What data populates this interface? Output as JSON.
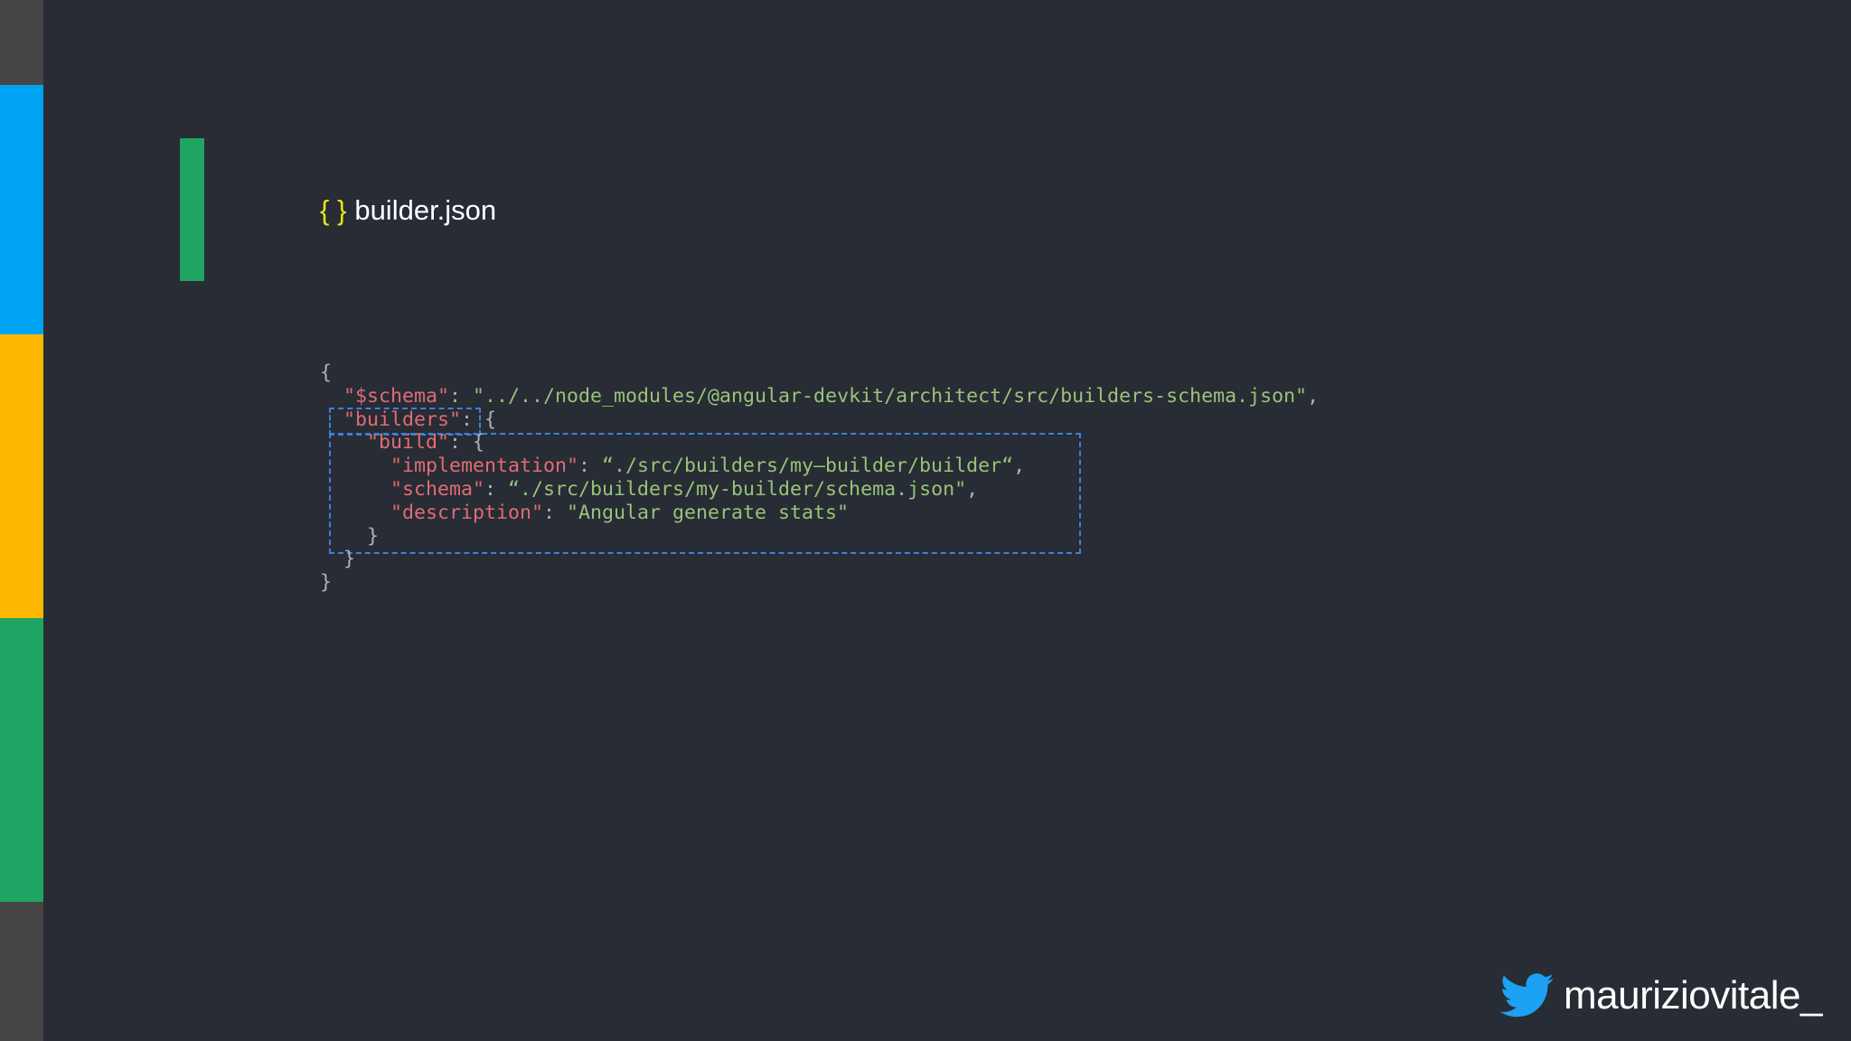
{
  "colors": {
    "background": "#282c34",
    "strip_dark": "#454545",
    "strip_blue": "#00a2f3",
    "strip_yellow": "#fdb900",
    "strip_green": "#1fa463",
    "title_icon": "#e5e510",
    "json_key": "#e06c75",
    "json_string": "#98c379",
    "highlight_border": "#3f7fd8",
    "twitter_blue": "#1da1f2"
  },
  "header": {
    "icon": "{ }",
    "icon_name": "json-file-icon",
    "filename": "builder.json"
  },
  "code": {
    "l1_open": "{",
    "l2_indent": "  ",
    "l2_key": "\"$schema\"",
    "l2_colon": ": ",
    "l2_value": "\"../../node_modules/@angular-devkit/architect/src/builders-schema.json\"",
    "l2_comma": ",",
    "l3_indent": "  ",
    "l3_key": "\"builders\"",
    "l3_rest": ": {",
    "l4_indent": "    ",
    "l4_key": "\"build\"",
    "l4_rest": ": {",
    "l5_indent": "      ",
    "l5_key": "\"implementation\"",
    "l5_colon": ": ",
    "l5_value": "“./src/builders/my–builder/builder“",
    "l5_comma": ",",
    "l6_indent": "      ",
    "l6_key": "\"schema\"",
    "l6_colon": ": ",
    "l6_value": "“./src/builders/my-builder/schema.json\"",
    "l6_comma": ",",
    "l7_indent": "      ",
    "l7_key": "\"description\"",
    "l7_colon": ": ",
    "l7_value": "\"Angular generate stats\"",
    "l8_close": "    }",
    "l9_close": "  }",
    "l10_close": "}"
  },
  "footer": {
    "icon_name": "twitter-bird-icon",
    "handle": "mauriziovitale_"
  }
}
